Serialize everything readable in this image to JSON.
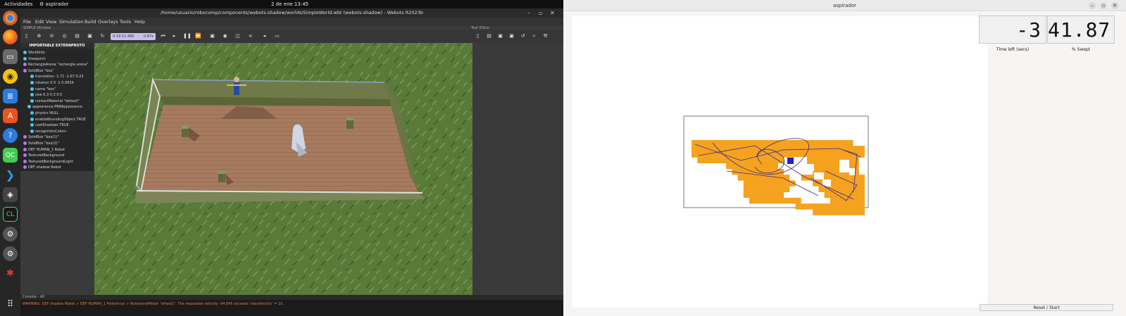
{
  "topbar": {
    "activities": "Actividades",
    "app_name": "aspirador",
    "clock": "2 de ene  13:45"
  },
  "dock": {
    "icons": [
      "chrome-icon",
      "firefox-icon",
      "files-icon",
      "rhythmbox-icon",
      "libreoffice-writer-icon",
      "app-center-icon",
      "help-icon",
      "qt-creator-icon",
      "vscode-icon",
      "unity-icon",
      "clion-icon",
      "webots-icon",
      "webots-icon-2",
      "bug-icon",
      "apps-grid-icon"
    ]
  },
  "webots": {
    "title": "/home/usuario/robocomp/components/webots-shadow/worlds/SimpleWorld.wbt (webots-shadow) - Webots R2023b",
    "menu": [
      "File",
      "Edit",
      "View",
      "Simulation",
      "Build",
      "Overlays",
      "Tools",
      "Help"
    ],
    "subtitle": "SIMPLE-Window",
    "right_subtitle": "Text Editor",
    "time": "0:19:11:480",
    "speed": "0.87x",
    "tree_header": "IMPORTABLE EXTERNPROTO",
    "tree_items": [
      {
        "label": "WorldInfo",
        "color": "#4ac8e8"
      },
      {
        "label": "Viewpoint",
        "color": "#4ac8e8"
      },
      {
        "label": "RectangleArena \"rectangle arena\"",
        "color": "#b07ce8"
      },
      {
        "label": "SolidBox \"box\"",
        "color": "#b07ce8"
      },
      {
        "label": "translation -1.71 -1.67 0.25",
        "color": "#4ac8e8"
      },
      {
        "label": "rotation 0 0 -1 0.0654",
        "color": "#4ac8e8"
      },
      {
        "label": "name \"box\"",
        "color": "#4ac8e8"
      },
      {
        "label": "size 0.3 0.3 0.5",
        "color": "#4ac8e8"
      },
      {
        "label": "contactMaterial \"default\"",
        "color": "#4ac8e8"
      },
      {
        "label": "appearance PBRAppearance",
        "color": "#4ac8e8"
      },
      {
        "label": "physics NULL",
        "color": "#4ac8e8"
      },
      {
        "label": "enableBoundingObject TRUE",
        "color": "#4ac8e8"
      },
      {
        "label": "castShadows TRUE",
        "color": "#4ac8e8"
      },
      {
        "label": "recognitionColors",
        "color": "#4ac8e8"
      },
      {
        "label": "SolidBox \"box(1)\"",
        "color": "#b07ce8"
      },
      {
        "label": "SolidBox \"box(2)\"",
        "color": "#b07ce8"
      },
      {
        "label": "DEF HUMAN_1 Robot",
        "color": "#b07ce8"
      },
      {
        "label": "TexturedBackground",
        "color": "#b07ce8"
      },
      {
        "label": "TexturedBackgroundLight",
        "color": "#b07ce8"
      },
      {
        "label": "DEF shadow Robot",
        "color": "#b07ce8"
      }
    ],
    "console_title": "Console - All",
    "console_text": "WARNING: DEF shadow Robot > DEF HUMAN_1 Pedestrian > RotationalMotor \"wheel1\": The requested velocity -94.845 exceeds 'maxVelocity' = 10."
  },
  "aspirador": {
    "title": "aspirador",
    "time_left_value": "-3",
    "swept_value": "41.87",
    "time_left_label": "Time left (secs)",
    "swept_label": "% Swept",
    "reset_label": "Reset / Start",
    "colors": {
      "swept": "#f5a21f",
      "robot": "#1f1fd0",
      "trail": "#3a2a8a"
    }
  }
}
